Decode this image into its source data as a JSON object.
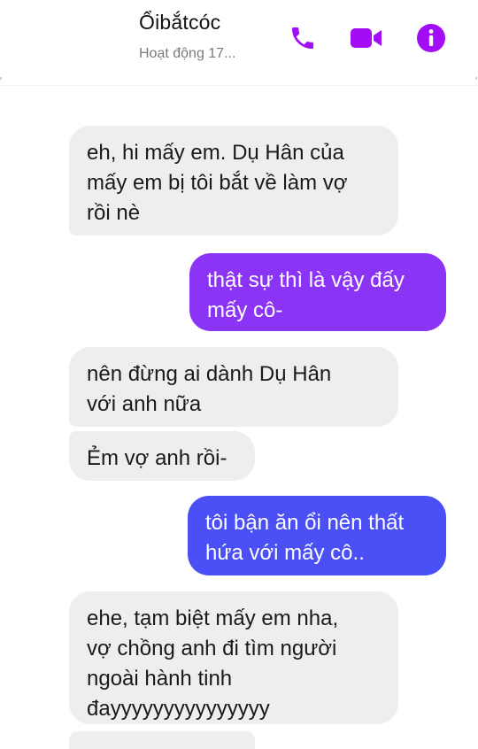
{
  "header": {
    "contact_name": "Ổibắtcóc",
    "status": "Hoạt động 17...",
    "accent_color": "#a20df5",
    "icons": [
      "phone-icon",
      "video-camera-icon",
      "info-icon"
    ]
  },
  "messages": [
    {
      "side": "received",
      "text": "eh, hi mấy em. Dụ Hân của\nmấy em bị tôi bắt về làm vợ\nrồi nè"
    },
    {
      "side": "sent",
      "text": "thật sự thì là vậy đấy\nmấy cô-",
      "color": "#8b34f5"
    },
    {
      "side": "received",
      "text": "nên đừng ai dành Dụ Hân\nvới anh nữa"
    },
    {
      "side": "received",
      "text": "Ẻm vợ anh rồi-"
    },
    {
      "side": "sent",
      "text": "tôi bận ăn ổi nên thất\nhứa với mấy cô..",
      "color": "#4a4ff6"
    },
    {
      "side": "received",
      "text": "ehe, tạm biệt mấy em nha,\nvợ chồng anh đi tìm người\nngoài hành tinh\nđayyyyyyyyyyyyyyy"
    }
  ]
}
